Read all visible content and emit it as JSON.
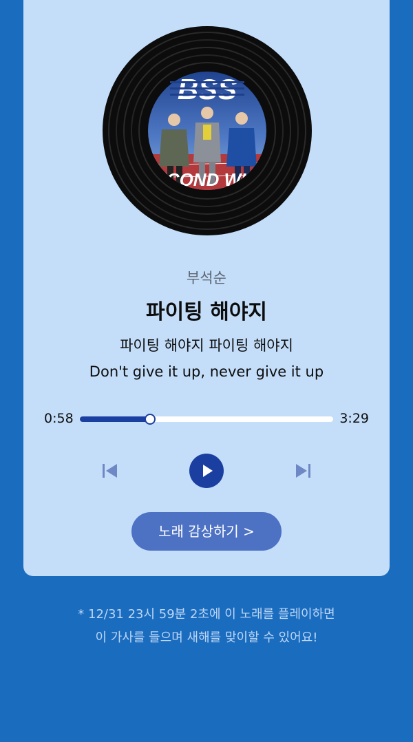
{
  "colors": {
    "background": "#1a6cbf",
    "card": "#c4defa",
    "accent": "#1a3fa0",
    "button": "#4d72c4"
  },
  "album": {
    "band_logo_text": "BSS",
    "album_text": "SECOND WIND"
  },
  "song": {
    "artist": "부석순",
    "title": "파이팅 해야지",
    "lyric_ko": "파이팅 해야지 파이팅 해야지",
    "lyric_en": "Don't give it up, never give it up"
  },
  "player": {
    "current_time": "0:58",
    "total_time": "3:29",
    "progress": 0.277,
    "prev_icon": "skip-previous-icon",
    "play_icon": "play-icon",
    "next_icon": "skip-next-icon"
  },
  "cta": {
    "label": "노래 감상하기 >"
  },
  "footnote": {
    "line1": "* 12/31 23시 59분 2초에 이 노래를 플레이하면",
    "line2": "이 가사를 들으며 새해를 맞이할 수 있어요!"
  }
}
